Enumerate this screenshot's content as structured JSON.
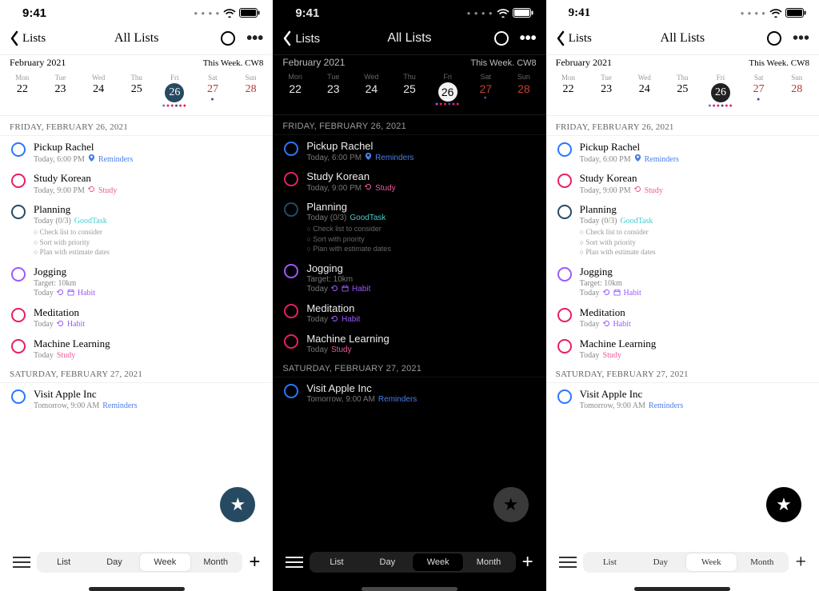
{
  "status": {
    "time": "9:41"
  },
  "nav": {
    "back": "Lists",
    "title": "All Lists"
  },
  "header": {
    "month": "February 2021",
    "week_info": "This Week. CW8"
  },
  "week": [
    {
      "dow": "Mon",
      "num": "22",
      "weekend": false
    },
    {
      "dow": "Tue",
      "num": "23",
      "weekend": false
    },
    {
      "dow": "Wed",
      "num": "24",
      "weekend": false
    },
    {
      "dow": "Thu",
      "num": "25",
      "weekend": false
    },
    {
      "dow": "Fri",
      "num": "26",
      "weekend": false,
      "today": true
    },
    {
      "dow": "Sat",
      "num": "27",
      "weekend": true
    },
    {
      "dow": "Sun",
      "num": "28",
      "weekend": true
    }
  ],
  "sections": [
    {
      "header": "FRIDAY, FEBRUARY 26, 2021",
      "tasks": [
        {
          "color": "blue",
          "title": "Pickup Rachel",
          "sub": "Today, 6:00 PM",
          "tag": "Reminders",
          "tag_color": "blue",
          "loc": true
        },
        {
          "color": "pink",
          "title": "Study Korean",
          "sub": "Today, 9:00 PM",
          "tag": "Study",
          "tag_color": "pink",
          "repeat": true
        },
        {
          "color": "dkblue",
          "title": "Planning",
          "sub": "Today (0/3)",
          "tag": "GoodTask",
          "tag_color": "teal",
          "notes": "○ Check list to consider\n○ Sort with priority\n○ Plan with estimate dates"
        },
        {
          "color": "purple",
          "title": "Jogging",
          "sub": "Target: 10km",
          "sub2": "Today",
          "tag": "Habit",
          "tag_color": "purple",
          "repeat": true,
          "cal": true
        },
        {
          "color": "pink",
          "title": "Meditation",
          "sub": "Today",
          "tag": "Habit",
          "tag_color": "purple",
          "repeat": true
        },
        {
          "color": "pink",
          "title": "Machine Learning",
          "sub": "Today",
          "tag": "Study",
          "tag_color": "pink"
        }
      ]
    },
    {
      "header": "SATURDAY, FEBRUARY 27, 2021",
      "tasks": [
        {
          "color": "blue",
          "title": "Visit Apple Inc",
          "sub": "Tomorrow, 9:00 AM",
          "tag": "Reminders",
          "tag_color": "blue"
        }
      ]
    }
  ],
  "segmented": {
    "options": [
      "List",
      "Day",
      "Week",
      "Month"
    ],
    "active": 2
  },
  "fab_icon": "★",
  "colors": {
    "blue": "#2a77ff",
    "pink": "#e91e63",
    "dkblue": "#274a63",
    "purple": "#9b59ff",
    "teal": "#4cc",
    "tag_pink": "#e85a9b"
  }
}
